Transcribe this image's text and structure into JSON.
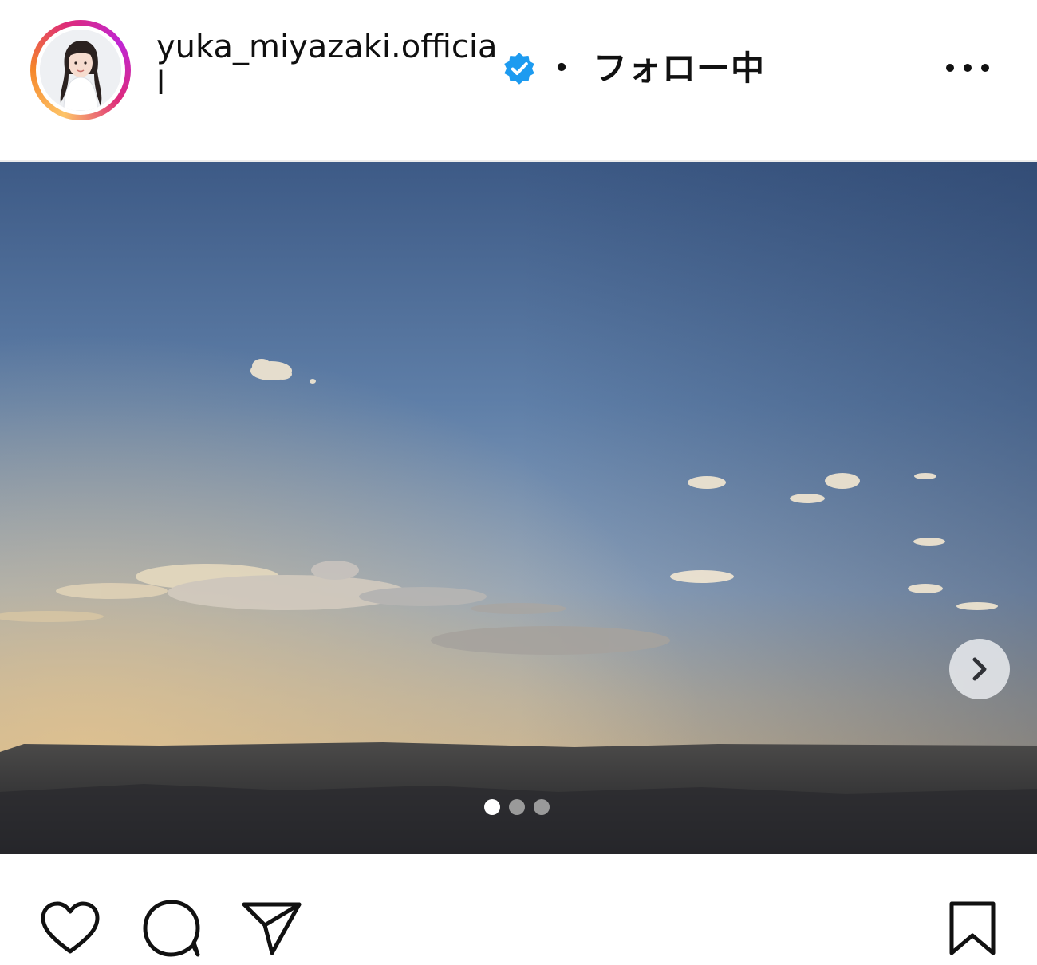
{
  "post": {
    "username": "yuka_miyazaki.official",
    "separator": "・",
    "follow_status": "フォロー中",
    "more_icon": "more-horizontal-icon",
    "verified_icon": "verified-badge-icon",
    "verified_color": "#1d9bf0"
  },
  "carousel": {
    "slide_count": 3,
    "active_index": 0,
    "next_icon": "chevron-right-icon",
    "dot_active_color": "#ffffff",
    "dot_inactive_color": "#9a9a9a"
  },
  "actions": {
    "like_icon": "heart-icon",
    "comment_icon": "comment-icon",
    "share_icon": "paper-plane-icon",
    "save_icon": "bookmark-icon"
  }
}
